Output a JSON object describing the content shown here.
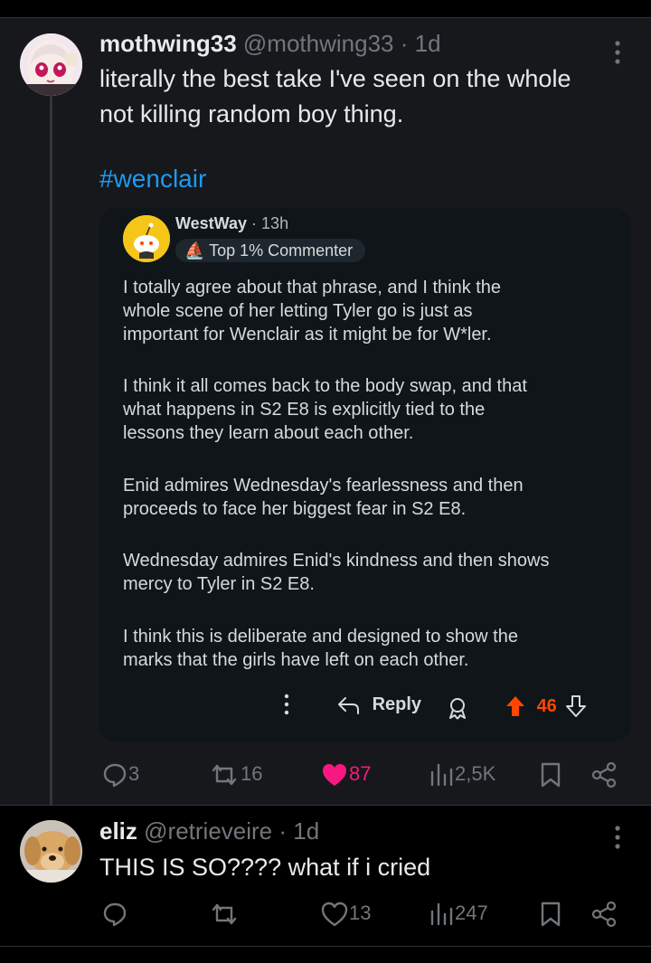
{
  "tweet1": {
    "name": "mothwing33",
    "handle": "@mothwing33",
    "time": "· 1d",
    "more": "⋮",
    "text_line1": "literally the best take I've seen on the whole",
    "text_line2": "not killing random boy thing.",
    "hashtag": "#wenclair",
    "embed": {
      "author": "WestWay",
      "time": "· 13h",
      "badge": "Top 1% Commenter",
      "paragraphs": [
        [
          "I totally agree about that phrase, and I think the",
          "whole scene of her letting Tyler go is just as",
          "important for Wenclair as it might be for W*ler."
        ],
        [
          "I think it all comes back to the body swap, and that",
          "what happens in S2 E8 is explicitly tied to the",
          "lessons they learn about each other."
        ],
        [
          "Enid admires Wednesday's fearlessness and then",
          "proceeds to face her biggest fear in S2 E8."
        ],
        [
          "Wednesday admires Enid's kindness and then shows",
          "mercy to Tyler in S2 E8."
        ],
        [
          "I think this is deliberate and designed to show the",
          "marks that the girls have left on each other."
        ]
      ],
      "more": "⋮",
      "reply_label": "Reply",
      "votes": "46"
    },
    "stats": {
      "replies": "3",
      "retweets": "16",
      "likes": "87",
      "views": "2,5K"
    }
  },
  "tweet2": {
    "name": "eliz",
    "handle": "@retrieveire",
    "time": "· 1d",
    "more": "⋮",
    "text": "THIS IS SO???? what if i cried",
    "stats": {
      "replies": "",
      "retweets": "",
      "likes": "13",
      "views": "247"
    }
  },
  "colors": {
    "accent": "#1d9bf0",
    "like": "#f91880",
    "upvote": "#ff4500",
    "muted": "#71767b"
  }
}
